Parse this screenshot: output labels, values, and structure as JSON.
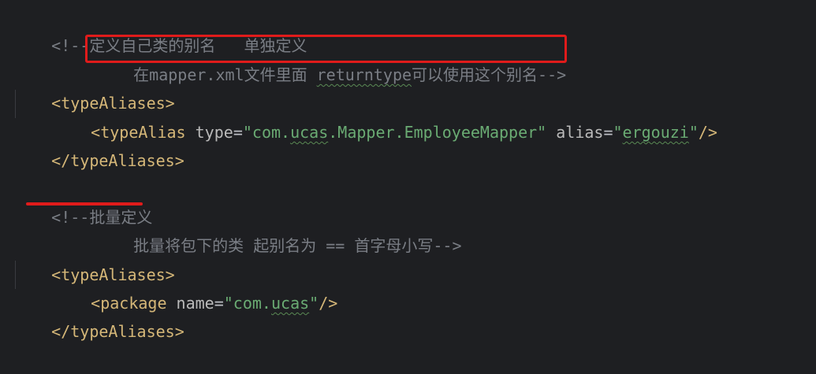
{
  "editor": {
    "colors": {
      "background": "#1e1f22",
      "comment": "#7a7e85",
      "tag": "#d5b778",
      "attribute": "#bababa",
      "string": "#6aab73",
      "highlight": "#e01b1b"
    },
    "line1": {
      "text": "<!--定义自己类的别名   单独定义"
    },
    "line2": {
      "pre": "在mapper.xml文件里面 ",
      "typo": "returntype",
      "post": "可以使用这个别名-->"
    },
    "line3": {
      "tag": "<typeAliases>"
    },
    "line4": {
      "open": "<typeAlias",
      "attr1": " type",
      "eq1": "=",
      "q1": "\"com.",
      "typo1": "ucas",
      "v1rest": ".Mapper.EmployeeMapper\"",
      "attr2": " alias",
      "eq2": "=",
      "q2": "\"",
      "typo2": "ergouzi",
      "q2end": "\"",
      "close": "/>"
    },
    "line5": {
      "tag": "</typeAliases>"
    },
    "line7": {
      "text": "<!--批量定义"
    },
    "line8": {
      "text": "批量将包下的类 起别名为 == 首字母小写-->"
    },
    "line9": {
      "tag": "<typeAliases>"
    },
    "line10": {
      "open": "<package",
      "attr": " name",
      "eq": "=",
      "q": "\"com.",
      "typo": "ucas",
      "qend": "\"",
      "close": "/>"
    },
    "line11": {
      "tag": "</typeAliases>"
    }
  }
}
